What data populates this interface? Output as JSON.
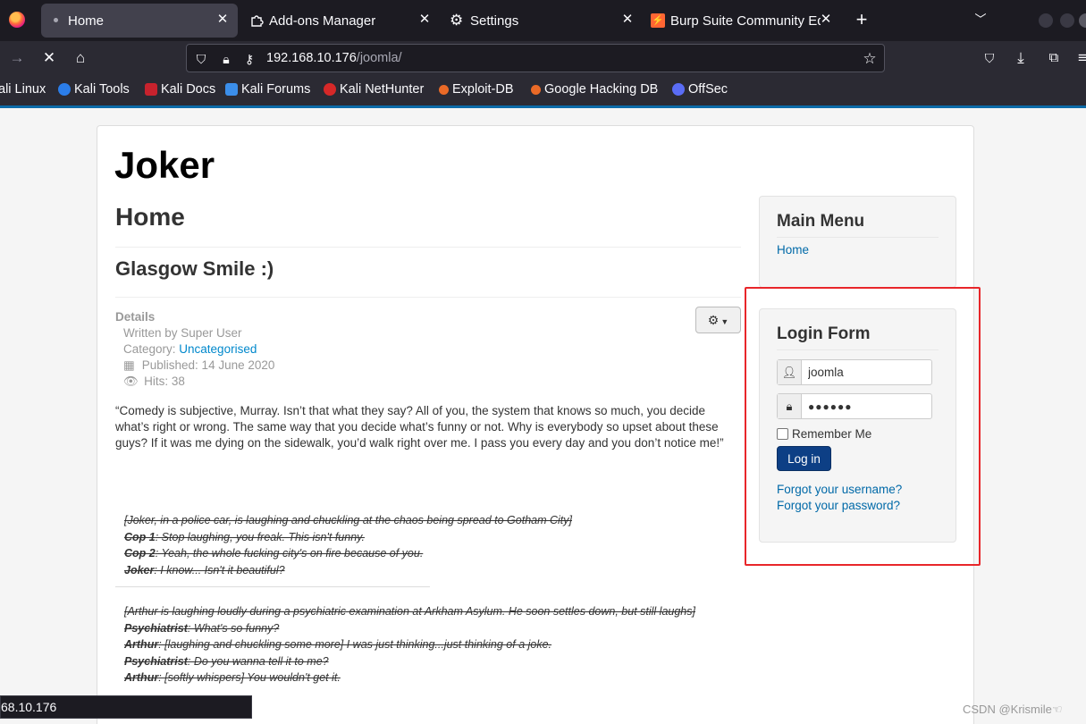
{
  "browser": {
    "tabs": [
      {
        "label": "Home",
        "icon": "dot-icon",
        "active": true
      },
      {
        "label": "Add-ons Manager",
        "icon": "puzzle-icon",
        "active": false
      },
      {
        "label": "Settings",
        "icon": "gear-icon",
        "active": false
      },
      {
        "label": "Burp Suite Community Ed",
        "icon": "burp-icon",
        "active": false
      }
    ],
    "url": {
      "host": "192.168.10.176",
      "path": "/joomla/"
    },
    "bookmarks": [
      {
        "label": "ali Linux",
        "color": "#367bf0"
      },
      {
        "label": "Kali Tools",
        "color": "#2b7de9"
      },
      {
        "label": "Kali Docs",
        "color": "#c7222d"
      },
      {
        "label": "Kali Forums",
        "color": "#3b8eea"
      },
      {
        "label": "Kali NetHunter",
        "color": "#d62828"
      },
      {
        "label": "Exploit-DB",
        "color": "#ea6a27"
      },
      {
        "label": "Google Hacking DB",
        "color": "#ea6a27"
      },
      {
        "label": "OffSec",
        "color": "#5a6cf5"
      }
    ],
    "status_url": "68.10.176"
  },
  "site": {
    "brand": "Joker",
    "page_title": "Home",
    "article_title": "Glasgow Smile :)",
    "details": {
      "heading": "Details",
      "author": "Written by Super User",
      "category_label": "Category: ",
      "category": "Uncategorised",
      "published": "Published: 14 June 2020",
      "hits": "Hits: 38"
    },
    "quote": "“Comedy is subjective, Murray. Isn’t that what they say? All of you, the system that knows so much, you decide what’s right or wrong. The same way that you decide what’s funny or not. Why is everybody so upset about these guys? If it was me dying on the sidewalk, you’d walk right over me. I pass you every day and you don’t notice me!”",
    "script1": {
      "intro": "[Joker, in a police car, is laughing and chuckling at the chaos being spread to Gotham City]",
      "lines": [
        {
          "speaker": "Cop 1",
          "text": ": Stop laughing, you freak. This isn't funny."
        },
        {
          "speaker": "Cop 2",
          "text": ": Yeah, the whole fucking city's on fire because of you."
        },
        {
          "speaker": "Joker",
          "text": ": I know... Isn't it beautiful?"
        }
      ]
    },
    "script2": {
      "intro": "[Arthur is laughing loudly during a psychiatric examination at Arkham Asylum. He soon settles down, but still laughs]",
      "lines": [
        {
          "speaker": "Psychiatrist",
          "text": ": What's so funny?"
        },
        {
          "speaker": "Arthur",
          "text": ": [laughing and chuckling some more] I was just thinking...just thinking of a joke."
        },
        {
          "speaker": "Psychiatrist",
          "text": ": Do you wanna tell it to me?"
        },
        {
          "speaker": "Arthur",
          "text": ": [softly whispers] You wouldn't get it."
        }
      ]
    },
    "main_menu": {
      "title": "Main Menu",
      "items": [
        "Home"
      ]
    },
    "login": {
      "title": "Login Form",
      "username": "joomla",
      "password": "●●●●●●",
      "remember": "Remember Me",
      "button": "Log in",
      "forgot_username": "Forgot your username?",
      "forgot_password": "Forgot your password?"
    }
  },
  "watermark": "CSDN @Krismile☜"
}
